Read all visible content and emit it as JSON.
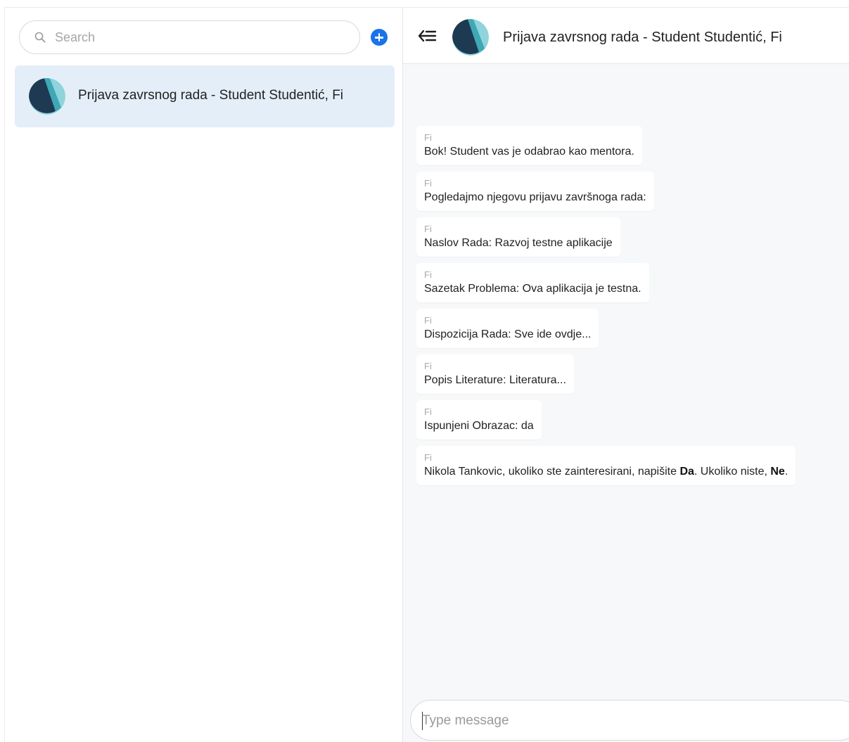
{
  "sidebar": {
    "search_placeholder": "Search",
    "conversations": [
      {
        "title": "Prijava zavrsnog rada - Student Studentić, Fi"
      }
    ]
  },
  "chat": {
    "title": "Prijava zavrsnog rada - Student Studentić, Fi",
    "messages": [
      {
        "sender": "Fi",
        "text": "Bok! Student vas je odabrao kao mentora."
      },
      {
        "sender": "Fi",
        "text": "Pogledajmo njegovu prijavu završnoga rada:"
      },
      {
        "sender": "Fi",
        "text": "Naslov Rada: Razvoj testne aplikacije"
      },
      {
        "sender": "Fi",
        "text": "Sazetak Problema: Ova aplikacija je testna."
      },
      {
        "sender": "Fi",
        "text": "Dispozicija Rada: Sve ide ovdje..."
      },
      {
        "sender": "Fi",
        "text": "Popis Literature: Literatura..."
      },
      {
        "sender": "Fi",
        "text": "Ispunjeni Obrazac: da"
      },
      {
        "sender": "Fi",
        "text_part1": "Nikola Tankovic, ukoliko ste zainteresirani, napišite ",
        "bold1": "Da",
        "text_part2": ". Ukoliko niste, ",
        "bold2": "Ne",
        "text_part3": "."
      }
    ],
    "composer_placeholder": "Type message"
  },
  "icons": {
    "search": "search-icon",
    "add": "plus-circle-icon",
    "back": "menu-back-icon",
    "avatar": "group-avatar"
  },
  "colors": {
    "accent": "#1a73e8",
    "selected_item": "#e4eef9",
    "avatar_dark": "#1e3a52",
    "avatar_teal": "#3fa7b5",
    "avatar_light": "#8fd4dc"
  }
}
